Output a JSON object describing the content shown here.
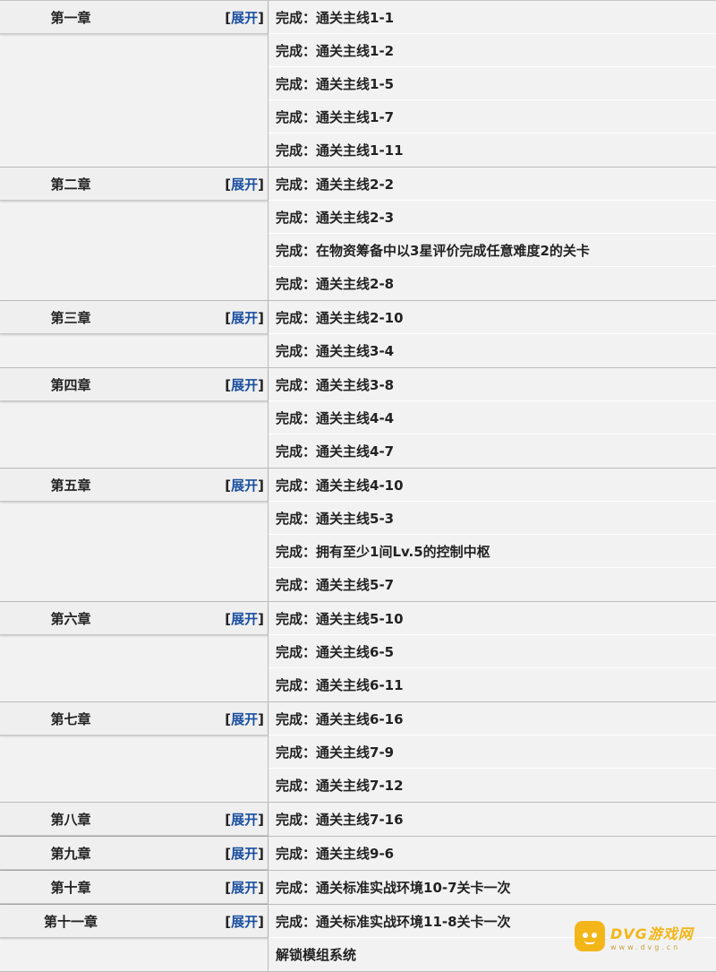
{
  "expand_text": "展开",
  "chapters": [
    {
      "title": "第一章",
      "tasks": [
        "完成：通关主线1-1",
        "完成：通关主线1-2",
        "完成：通关主线1-5",
        "完成：通关主线1-7",
        "完成：通关主线1-11"
      ]
    },
    {
      "title": "第二章",
      "tasks": [
        "完成：通关主线2-2",
        "完成：通关主线2-3",
        "完成：在物资筹备中以3星评价完成任意难度2的关卡",
        "完成：通关主线2-8"
      ]
    },
    {
      "title": "第三章",
      "tasks": [
        "完成：通关主线2-10",
        "完成：通关主线3-4"
      ]
    },
    {
      "title": "第四章",
      "tasks": [
        "完成：通关主线3-8",
        "完成：通关主线4-4",
        "完成：通关主线4-7"
      ]
    },
    {
      "title": "第五章",
      "tasks": [
        "完成：通关主线4-10",
        "完成：通关主线5-3",
        "完成：拥有至少1间Lv.5的控制中枢",
        "完成：通关主线5-7"
      ]
    },
    {
      "title": "第六章",
      "tasks": [
        "完成：通关主线5-10",
        "完成：通关主线6-5",
        "完成：通关主线6-11"
      ]
    },
    {
      "title": "第七章",
      "tasks": [
        "完成：通关主线6-16",
        "完成：通关主线7-9",
        "完成：通关主线7-12"
      ]
    },
    {
      "title": "第八章",
      "tasks": [
        "完成：通关主线7-16"
      ]
    },
    {
      "title": "第九章",
      "tasks": [
        "完成：通关主线9-6"
      ]
    },
    {
      "title": "第十章",
      "tasks": [
        "完成：通关标准实战环境10-7关卡一次"
      ]
    },
    {
      "title": "第十一章",
      "tasks": [
        "完成：通关标准实战环境11-8关卡一次",
        "解锁模组系统"
      ]
    }
  ],
  "watermark": {
    "title": "DVG游戏网",
    "subtitle": "www.dvg.cn",
    "color": "#f3b619"
  }
}
